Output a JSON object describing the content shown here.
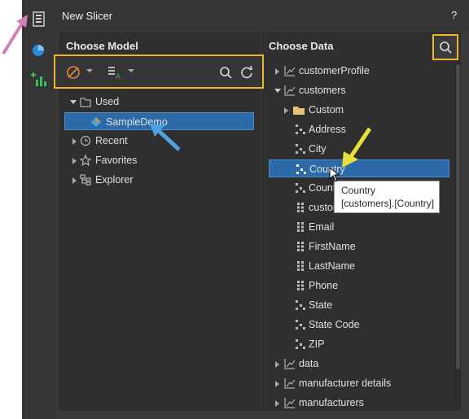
{
  "dialog": {
    "title": "New Slicer",
    "help": "?"
  },
  "model_panel": {
    "title": "Choose Model",
    "tree": [
      {
        "label": "Used"
      },
      {
        "label": "SampleDemo"
      },
      {
        "label": "Recent"
      },
      {
        "label": "Favorites"
      },
      {
        "label": "Explorer"
      }
    ]
  },
  "data_panel": {
    "title": "Choose Data",
    "tree": [
      {
        "label": "customerProfile"
      },
      {
        "label": "customers"
      },
      {
        "label": "Custom"
      },
      {
        "label": "Address"
      },
      {
        "label": "City"
      },
      {
        "label": "Country"
      },
      {
        "label": "Count"
      },
      {
        "label": "custom"
      },
      {
        "label": "Email"
      },
      {
        "label": "FirstName"
      },
      {
        "label": "LastName"
      },
      {
        "label": "Phone"
      },
      {
        "label": "State"
      },
      {
        "label": "State Code"
      },
      {
        "label": "ZIP"
      },
      {
        "label": "data"
      },
      {
        "label": "manufacturer details"
      },
      {
        "label": "manufacturers"
      }
    ]
  },
  "tooltip": {
    "line1": "Country",
    "line2": "[customers].[Country]"
  },
  "colors": {
    "highlight": "#f0b429",
    "selection": "#2d6ba8",
    "accent_arrow_yellow": "#e8e03a",
    "accent_arrow_blue": "#4da3e0",
    "accent_arrow_pink": "#d47fb8"
  }
}
